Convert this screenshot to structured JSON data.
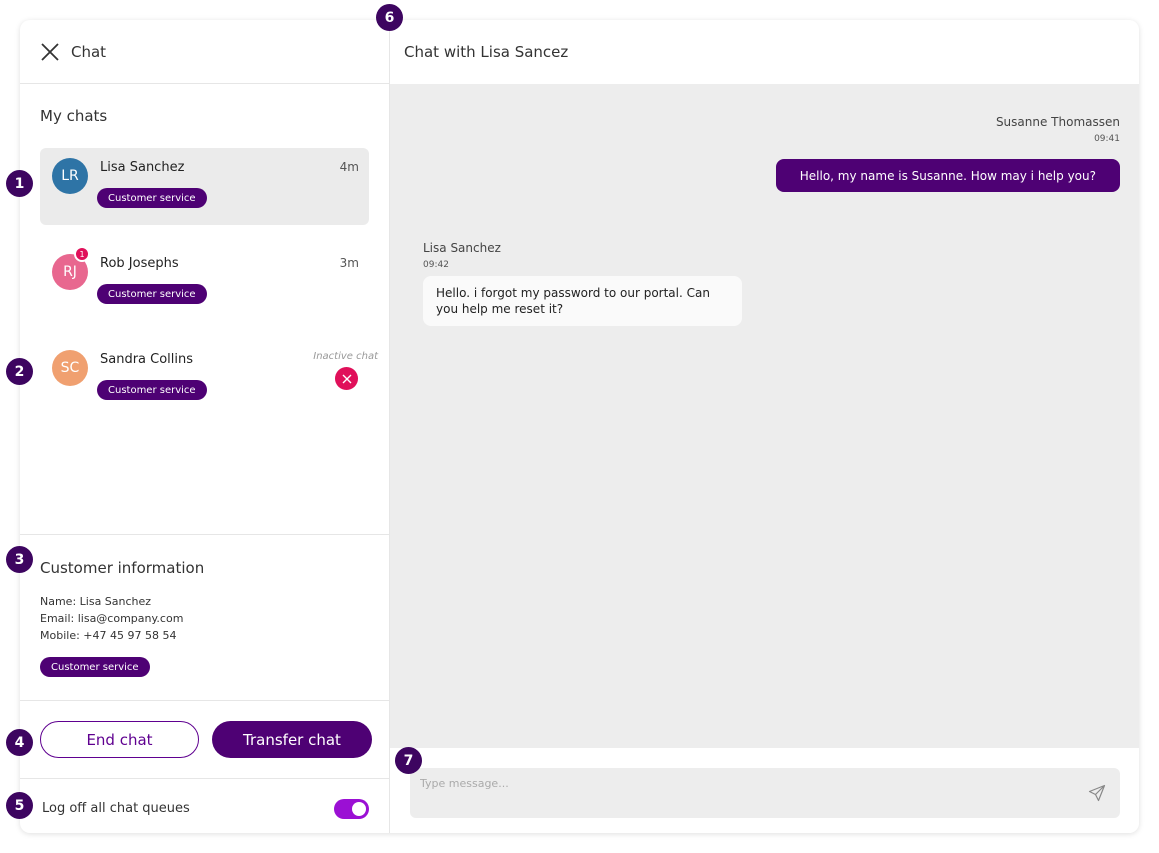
{
  "sidebar": {
    "header_title": "Chat",
    "section_title": "My chats",
    "chats": [
      {
        "initials": "LR",
        "name": "Lisa Sanchez",
        "time": "4m",
        "tag": "Customer service",
        "avatar_color": "#2e74a6"
      },
      {
        "initials": "RJ",
        "name": "Rob Josephs",
        "time": "3m",
        "tag": "Customer service",
        "avatar_color": "#e8678f",
        "unread": "1"
      },
      {
        "initials": "SC",
        "name": "Sandra Collins",
        "status": "Inactive chat",
        "tag": "Customer service",
        "avatar_color": "#f0a070"
      }
    ]
  },
  "customer_info": {
    "title": "Customer information",
    "name_line": "Name: Lisa Sanchez",
    "email_line": "Email: lisa@company.com",
    "mobile_line": "Mobile: +47 45 97 58 54",
    "tag": "Customer service"
  },
  "actions": {
    "end_label": "End chat",
    "transfer_label": "Transfer chat"
  },
  "logoff": {
    "label": "Log off all chat queues",
    "enabled": true
  },
  "conversation": {
    "title": "Chat with Lisa Sancez",
    "messages": [
      {
        "sender": "Susanne Thomassen",
        "time": "09:41",
        "text": "Hello, my name is Susanne. How may i help you?",
        "direction": "outgoing"
      },
      {
        "sender": "Lisa Sanchez",
        "time": "09:42",
        "text": "Hello. i forgot my password to our portal. Can you help me reset it?",
        "direction": "incoming"
      }
    ]
  },
  "composer": {
    "placeholder": "Type message..."
  },
  "markers": [
    "1",
    "2",
    "3",
    "4",
    "5",
    "6",
    "7"
  ],
  "colors": {
    "brand": "#4e0174",
    "danger": "#e0105a",
    "toggle": "#9b10d4",
    "panel_bg": "#ededed"
  }
}
